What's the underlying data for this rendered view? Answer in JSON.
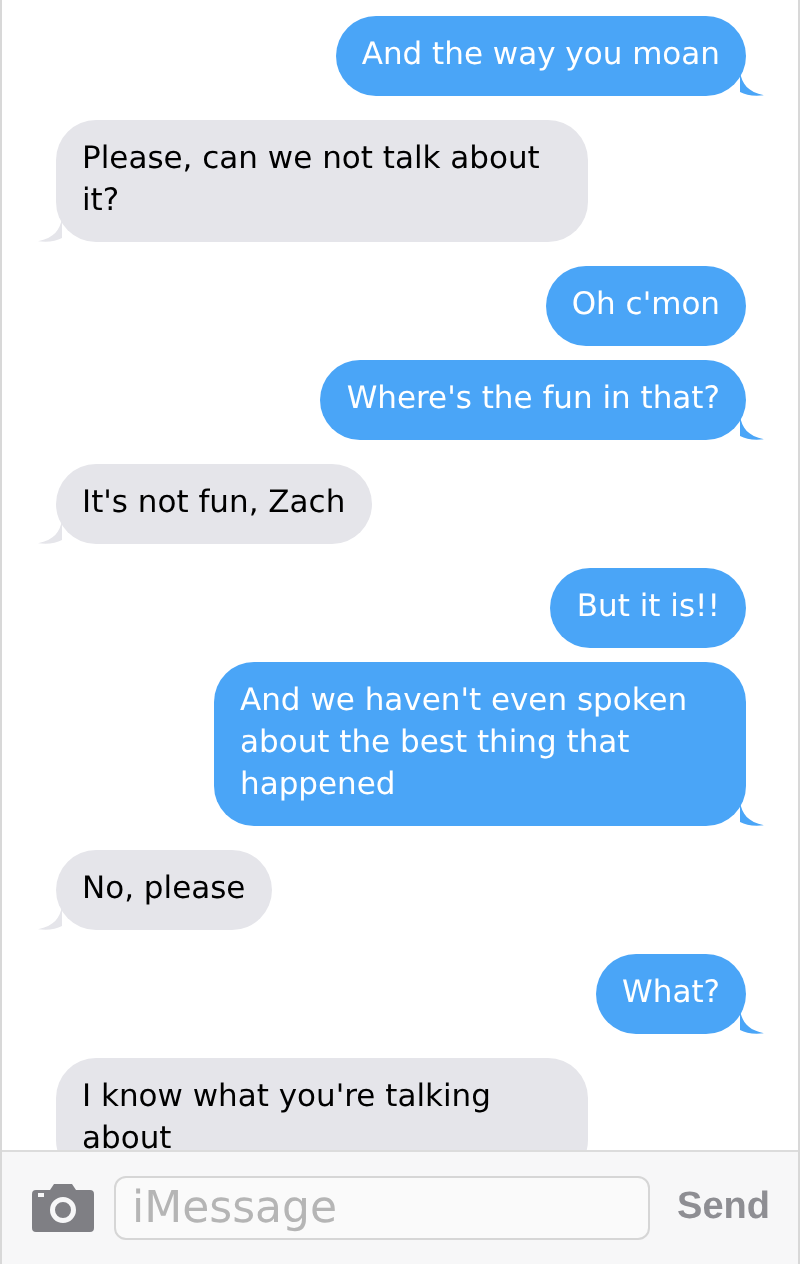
{
  "messages": [
    {
      "kind": "sent",
      "text": "And the way you moan",
      "tail": true
    },
    {
      "kind": "received",
      "text": "Please, can we not talk about it?",
      "tail": true
    },
    {
      "kind": "sent",
      "text": "Oh c'mon",
      "tail": false
    },
    {
      "kind": "sent",
      "text": "Where's the fun in that?",
      "tail": true
    },
    {
      "kind": "received",
      "text": "It's not fun, Zach",
      "tail": true
    },
    {
      "kind": "sent",
      "text": "But it is!!",
      "tail": false
    },
    {
      "kind": "sent",
      "text": "And we haven't even spoken about the best thing that happened",
      "tail": true
    },
    {
      "kind": "received",
      "text": "No, please",
      "tail": true
    },
    {
      "kind": "sent",
      "text": "What?",
      "tail": true
    },
    {
      "kind": "received",
      "text": "I know what you're talking about",
      "tail": false
    }
  ],
  "composer": {
    "placeholder": "iMessage",
    "send_label": "Send"
  }
}
